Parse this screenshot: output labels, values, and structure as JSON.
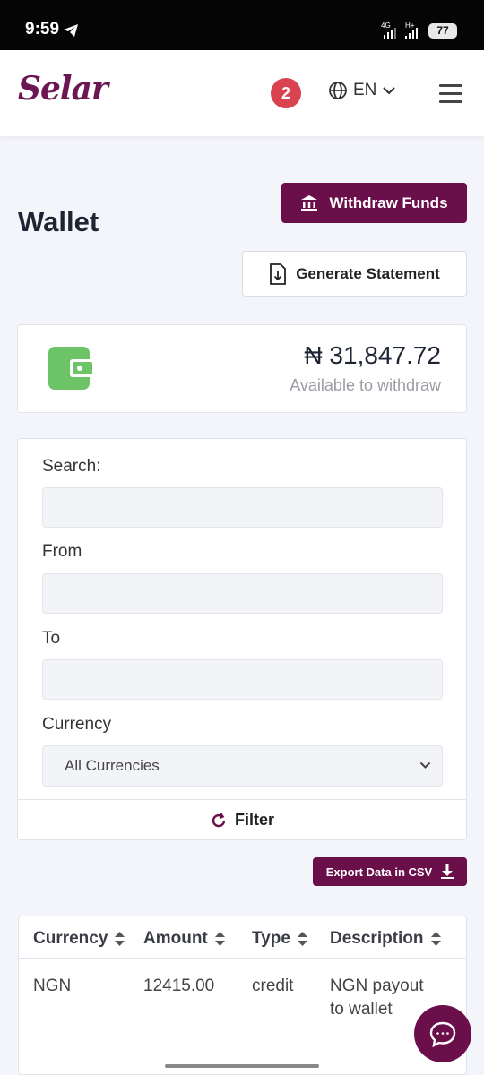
{
  "status_bar": {
    "time": "9:59",
    "net1": "4G",
    "net2": "H+",
    "battery": "77"
  },
  "navbar": {
    "logo": "Selar",
    "notification_count": "2",
    "language": "EN"
  },
  "page": {
    "title": "Wallet",
    "withdraw_label": "Withdraw Funds",
    "statement_label": "Generate Statement"
  },
  "balance": {
    "amount": "₦ 31,847.72",
    "label": "Available to withdraw"
  },
  "filters": {
    "search_label": "Search:",
    "from_label": "From",
    "to_label": "To",
    "currency_label": "Currency",
    "currency_value": "All Currencies",
    "filter_label": "Filter"
  },
  "export_label": "Export Data in CSV",
  "table": {
    "headers": [
      "Currency",
      "Amount",
      "Type",
      "Description"
    ],
    "rows": [
      {
        "currency": "NGN",
        "amount": "12415.00",
        "type": "credit",
        "description_line1": "NGN payout",
        "description_line2": "to wallet"
      }
    ]
  },
  "colors": {
    "brand": "#6b0f4b",
    "badge": "#d9434f",
    "wallet_icon": "#6cc467"
  }
}
